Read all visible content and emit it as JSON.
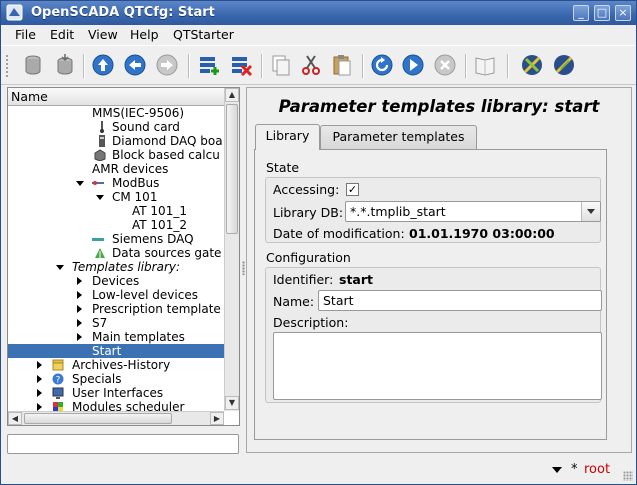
{
  "window": {
    "title": "OpenSCADA QTCfg: Start"
  },
  "menu": [
    {
      "label": "File"
    },
    {
      "label": "Edit"
    },
    {
      "label": "View"
    },
    {
      "label": "Help"
    },
    {
      "label": "QTStarter"
    }
  ],
  "toolbar": {
    "buttons": [
      {
        "icon": "db-load-icon"
      },
      {
        "icon": "db-save-icon"
      },
      {
        "icon": "up-icon"
      },
      {
        "icon": "back-icon"
      },
      {
        "icon": "forward-icon"
      },
      {
        "icon": "add-item-icon"
      },
      {
        "icon": "delete-item-icon"
      },
      {
        "icon": "copy-icon"
      },
      {
        "icon": "cut-icon"
      },
      {
        "icon": "paste-icon"
      },
      {
        "icon": "refresh-icon"
      },
      {
        "icon": "start-icon"
      },
      {
        "icon": "stop-icon"
      },
      {
        "icon": "manual-icon"
      },
      {
        "icon": "ui-tool-icon"
      },
      {
        "icon": "ui-tool-2-icon"
      }
    ]
  },
  "tree": {
    "header": "Name",
    "items": [
      {
        "label": "MMS(IEC-9506)"
      },
      {
        "label": "Sound card"
      },
      {
        "label": "Diamond DAQ boa"
      },
      {
        "label": "Block based calcu"
      },
      {
        "label": "AMR devices"
      },
      {
        "label": "ModBus"
      },
      {
        "label": "CM 101"
      },
      {
        "label": "AT 101_1"
      },
      {
        "label": "AT 101_2"
      },
      {
        "label": "Siemens DAQ"
      },
      {
        "label": "Data sources gate"
      },
      {
        "label": "Templates library:"
      },
      {
        "label": "Devices"
      },
      {
        "label": "Low-level devices"
      },
      {
        "label": "Prescription template"
      },
      {
        "label": "S7"
      },
      {
        "label": "Main templates"
      },
      {
        "label": "Start"
      },
      {
        "label": "Archives-History"
      },
      {
        "label": "Specials"
      },
      {
        "label": "User Interfaces"
      },
      {
        "label": "Modules scheduler"
      }
    ]
  },
  "page": {
    "title": "Parameter templates library: start",
    "tabs": [
      {
        "label": "Library"
      },
      {
        "label": "Parameter templates"
      }
    ],
    "state": {
      "title": "State",
      "accessing_label": "Accessing:",
      "accessing_mark": "✓",
      "library_db_label": "Library DB:",
      "library_db_value": "*.*.tmplib_start",
      "date_label": "Date of modification:",
      "date_value": "01.01.1970 03:00:00"
    },
    "configuration": {
      "title": "Configuration",
      "identifier_label": "Identifier:",
      "identifier_value": "start",
      "name_label": "Name:",
      "name_value": "Start",
      "description_label": "Description:"
    }
  },
  "status": {
    "star": "*",
    "user": "root"
  },
  "colors": {
    "selection": "#3c72b4",
    "titlebar": "#3a66ad",
    "user": "#cc0000"
  }
}
